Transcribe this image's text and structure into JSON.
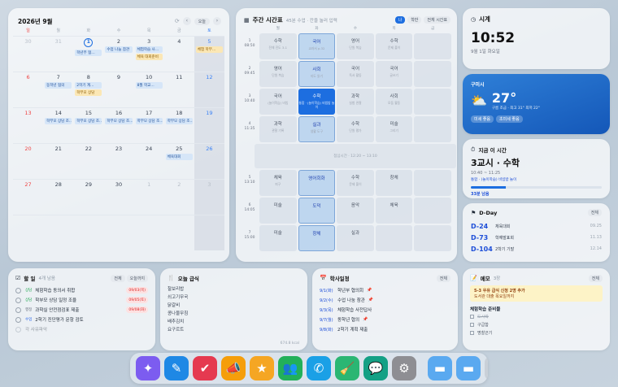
{
  "calendar": {
    "title": "2026년 9월",
    "today_label": "오늘",
    "weekdays": [
      "일",
      "월",
      "화",
      "수",
      "목",
      "금",
      "토"
    ],
    "weeks": [
      [
        {
          "d": "30",
          "o": true
        },
        {
          "d": "31",
          "o": true
        },
        {
          "d": "1",
          "today": true,
          "ev": [
            {
              "t": "학년부 협…",
              "c": "b"
            }
          ]
        },
        {
          "d": "2",
          "ev": [
            {
              "t": "수업 나눔 참관",
              "c": "b"
            }
          ]
        },
        {
          "d": "3",
          "ev": [
            {
              "t": "체험학습 사…",
              "c": "b"
            },
            {
              "t": "체육 대회준비",
              "c": "y"
            }
          ]
        },
        {
          "d": "4"
        },
        {
          "d": "5",
          "sat": true,
          "ev": [
            {
              "t": "체험 학부…",
              "c": "y"
            }
          ]
        }
      ],
      [
        {
          "d": "6",
          "sun": true
        },
        {
          "d": "7",
          "ev": [
            {
              "t": "동학년 협의",
              "c": "b"
            }
          ]
        },
        {
          "d": "8",
          "ev": [
            {
              "t": "2학기 계…",
              "c": "b"
            },
            {
              "t": "학부모 상담",
              "c": "y"
            }
          ]
        },
        {
          "d": "9"
        },
        {
          "d": "10",
          "ev": [
            {
              "t": "8월 학교…",
              "c": "b"
            }
          ]
        },
        {
          "d": "11"
        },
        {
          "d": "12",
          "sat": true
        }
      ],
      [
        {
          "d": "13",
          "sun": true
        },
        {
          "d": "14",
          "ev": [
            {
              "t": "학부모 상담 조…",
              "c": "b"
            }
          ]
        },
        {
          "d": "15",
          "ev": [
            {
              "t": "학부모 상담 조…",
              "c": "b"
            }
          ]
        },
        {
          "d": "16",
          "ev": [
            {
              "t": "학부모 상담 조…",
              "c": "b"
            }
          ]
        },
        {
          "d": "17",
          "ev": [
            {
              "t": "학부모 상담 조…",
              "c": "b"
            }
          ]
        },
        {
          "d": "18",
          "ev": [
            {
              "t": "학부모 상담 조…",
              "c": "b"
            }
          ]
        },
        {
          "d": "19",
          "sat": true
        }
      ],
      [
        {
          "d": "20",
          "sun": true
        },
        {
          "d": "21"
        },
        {
          "d": "22"
        },
        {
          "d": "23"
        },
        {
          "d": "24"
        },
        {
          "d": "25",
          "ev": [
            {
              "t": "체육대회",
              "c": "b"
            }
          ]
        },
        {
          "d": "26",
          "sat": true
        }
      ],
      [
        {
          "d": "27",
          "sun": true
        },
        {
          "d": "28"
        },
        {
          "d": "29"
        },
        {
          "d": "30"
        },
        {
          "d": "1",
          "o": true
        },
        {
          "d": "2",
          "o": true
        },
        {
          "d": "3",
          "o": true,
          "sat": true
        }
      ],
      [
        {
          "d": ""
        },
        {
          "d": ""
        },
        {
          "d": ""
        },
        {
          "d": ""
        },
        {
          "d": ""
        },
        {
          "d": ""
        },
        {
          "d": "",
          "sat": true
        }
      ]
    ]
  },
  "timetable": {
    "title": "주간 시간표",
    "subtitle": "45분 수업 · 칸을 눌러 입력",
    "toggle_me": "나",
    "toggle_class": "학반",
    "toggle_all": "전체 시간표",
    "days": [
      "월",
      "화",
      "수",
      "목",
      "금"
    ],
    "periods": [
      {
        "n": "1",
        "t": "08:50",
        "cells": [
          {
            "s": "수학",
            "m": "전체 진도 3-1"
          },
          {
            "s": "국어",
            "m": "교과서 p.32",
            "hl": true
          },
          {
            "s": "영어",
            "m": "단원 복습"
          },
          {
            "s": "수학",
            "m": "문제 풀이"
          },
          {
            "s": "",
            "m": ""
          }
        ]
      },
      {
        "n": "2",
        "t": "09:45",
        "cells": [
          {
            "s": "영어",
            "m": "단원 복습"
          },
          {
            "s": "사회",
            "m": "지도 읽기",
            "hl": true
          },
          {
            "s": "국어",
            "m": "독서 활동"
          },
          {
            "s": "국어",
            "m": "글쓰기"
          },
          {
            "s": "",
            "m": ""
          }
        ]
      },
      {
        "n": "3",
        "t": "10:40",
        "cells": [
          {
            "s": "국어",
            "m": "(놀이학습) 비빔"
          },
          {
            "s": "수학",
            "m": "통합 · (놀이학습) 비빔밥 놀이",
            "cur": true
          },
          {
            "s": "과학",
            "m": "실험 관찰"
          },
          {
            "s": "사회",
            "m": "모둠 활동"
          },
          {
            "s": "",
            "m": ""
          }
        ]
      },
      {
        "n": "4",
        "t": "11:35",
        "cells": [
          {
            "s": "과학",
            "m": "관찰 기록"
          },
          {
            "s": "실과",
            "m": "생활 도구",
            "hl": true
          },
          {
            "s": "수학",
            "m": "단원 평가"
          },
          {
            "s": "미술",
            "m": "그리기"
          },
          {
            "s": "",
            "m": ""
          }
        ]
      }
    ],
    "lunch": "점심시간 · 12:20 ~ 13:10",
    "periods_pm": [
      {
        "n": "5",
        "t": "13:10",
        "cells": [
          {
            "s": "체육",
            "m": "피구"
          },
          {
            "s": "영어회화",
            "m": "",
            "hl": true
          },
          {
            "s": "수학",
            "m": "문제 풀이"
          },
          {
            "s": "창체",
            "m": ""
          },
          {
            "s": "",
            "m": ""
          }
        ]
      },
      {
        "n": "6",
        "t": "14:05",
        "cells": [
          {
            "s": "미술",
            "m": ""
          },
          {
            "s": "도덕",
            "m": "",
            "hl": true
          },
          {
            "s": "음악",
            "m": ""
          },
          {
            "s": "체육",
            "m": ""
          },
          {
            "s": "",
            "m": ""
          }
        ]
      },
      {
        "n": "7",
        "t": "15:00",
        "cells": [
          {
            "s": "미술",
            "m": ""
          },
          {
            "s": "창체",
            "m": "",
            "hl": true
          },
          {
            "s": "실과",
            "m": ""
          },
          {
            "s": "",
            "m": ""
          },
          {
            "s": "",
            "m": ""
          }
        ]
      }
    ]
  },
  "clock": {
    "title": "시계",
    "time": "10:52",
    "date": "9월 1일 화요일"
  },
  "weather": {
    "location": "구미시",
    "temp": "27°",
    "desc": "구름 조금 · 최고 31° 최저 22°",
    "chip1": "미세 좋음",
    "chip2": "초미세 좋음"
  },
  "now": {
    "title": "지금 이 시간",
    "period": "3교시 · 수학",
    "range": "10:40 ~ 11:25",
    "detail": "통합 · (놀이학습) 비빔밥 놀이",
    "remaining": "33분 남음",
    "progress": 0.27
  },
  "dday": {
    "title": "D-Day",
    "all": "전체",
    "items": [
      {
        "d": "D-24",
        "name": "체육대회",
        "date": "09.25"
      },
      {
        "d": "D-73",
        "name": "학예발표회",
        "date": "11.13"
      },
      {
        "d": "D-104",
        "name": "2학기 기말",
        "date": "12.14"
      }
    ]
  },
  "todo": {
    "title": "할 일",
    "count": "4개 남음",
    "tab_all": "전체",
    "tab_done": "오늘까지",
    "items": [
      {
        "tag": "상담",
        "tc": "#16a34a",
        "text": "체험학습 동의서 취합",
        "due": "09/03(목)"
      },
      {
        "tag": "상담",
        "tc": "#16a34a",
        "text": "학부모 상담 일정 조율",
        "due": "09/05(토)"
      },
      {
        "tag": "행정",
        "tc": "#6b7280",
        "text": "과학실 안전점검표 제출",
        "due": "09/08(화)"
      },
      {
        "tag": "수업",
        "tc": "#2563eb",
        "text": "2학기 진단평가 문항 검토",
        "due": ""
      },
      {
        "tag": "",
        "tc": "#6b7280",
        "text": "각 사유파악",
        "due": ""
      }
    ]
  },
  "lunch": {
    "title": "오늘 급식",
    "items": [
      "찰보리밥",
      "쇠고기무국",
      "닭갈비",
      "콩나물무침",
      "배추김치",
      "요구르트"
    ],
    "kcal": "674.8 kcal"
  },
  "sched": {
    "title": "학사일정",
    "all": "전체",
    "items": [
      {
        "d": "9/1(화)",
        "t": "학년부 협의회",
        "pin": true
      },
      {
        "d": "9/2(수)",
        "t": "수업 나눔 참관",
        "pin": true
      },
      {
        "d": "9/3(목)",
        "t": "체험학습 사전답사",
        "pin": false
      },
      {
        "d": "9/7(월)",
        "t": "동학년 협의",
        "pin": true
      },
      {
        "d": "9/8(화)",
        "t": "2학기 계획 제출",
        "pin": false
      }
    ]
  },
  "memo": {
    "title": "메모",
    "count": "3장",
    "all": "전체",
    "note1": "5-3 우유 급식 신청 2명 추가",
    "note2": "도서관 대출 목요일까지",
    "list_title": "체험학습 준비물",
    "list": [
      "도시락",
      "구급함",
      "명찰끈기"
    ]
  },
  "dock": {
    "apps": [
      {
        "name": "ai-assistant-icon",
        "bg": "#7c5cf0",
        "g": "✦"
      },
      {
        "name": "pen-icon",
        "bg": "#1e88e5",
        "g": "✎"
      },
      {
        "name": "checklist-icon",
        "bg": "#e53950",
        "g": "✔"
      },
      {
        "name": "megaphone-icon",
        "bg": "#f59e0b",
        "g": "📣"
      },
      {
        "name": "star-icon",
        "bg": "#f5a623",
        "g": "★"
      },
      {
        "name": "people-icon",
        "bg": "#22b05a",
        "g": "👥"
      },
      {
        "name": "phone-icon",
        "bg": "#1aa0e6",
        "g": "✆"
      },
      {
        "name": "broom-icon",
        "bg": "#2bb673",
        "g": "🧹"
      },
      {
        "name": "chat-icon",
        "bg": "#14a085",
        "g": "💬"
      },
      {
        "name": "settings-icon",
        "bg": "#8e8e93",
        "g": "⚙"
      },
      {
        "name": "folder-icon",
        "bg": "#5aa9f0",
        "g": "▬"
      },
      {
        "name": "folder-icon",
        "bg": "#5aa9f0",
        "g": "▬"
      },
      {
        "name": "trash-icon",
        "bg": "#c9d0d8",
        "g": "🗑"
      }
    ]
  }
}
